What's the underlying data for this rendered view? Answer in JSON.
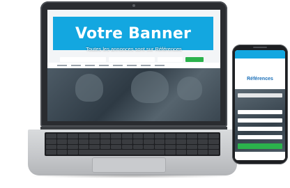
{
  "banner": {
    "text": "Votre Banner"
  },
  "laptop": {
    "hero_title": "Toutes les annonces sont sur Références"
  },
  "phone": {
    "logo": "Références"
  },
  "colors": {
    "banner_blue": "#13a7e0",
    "search_green": "#2bb24c",
    "logo_blue": "#1a6fb8"
  }
}
